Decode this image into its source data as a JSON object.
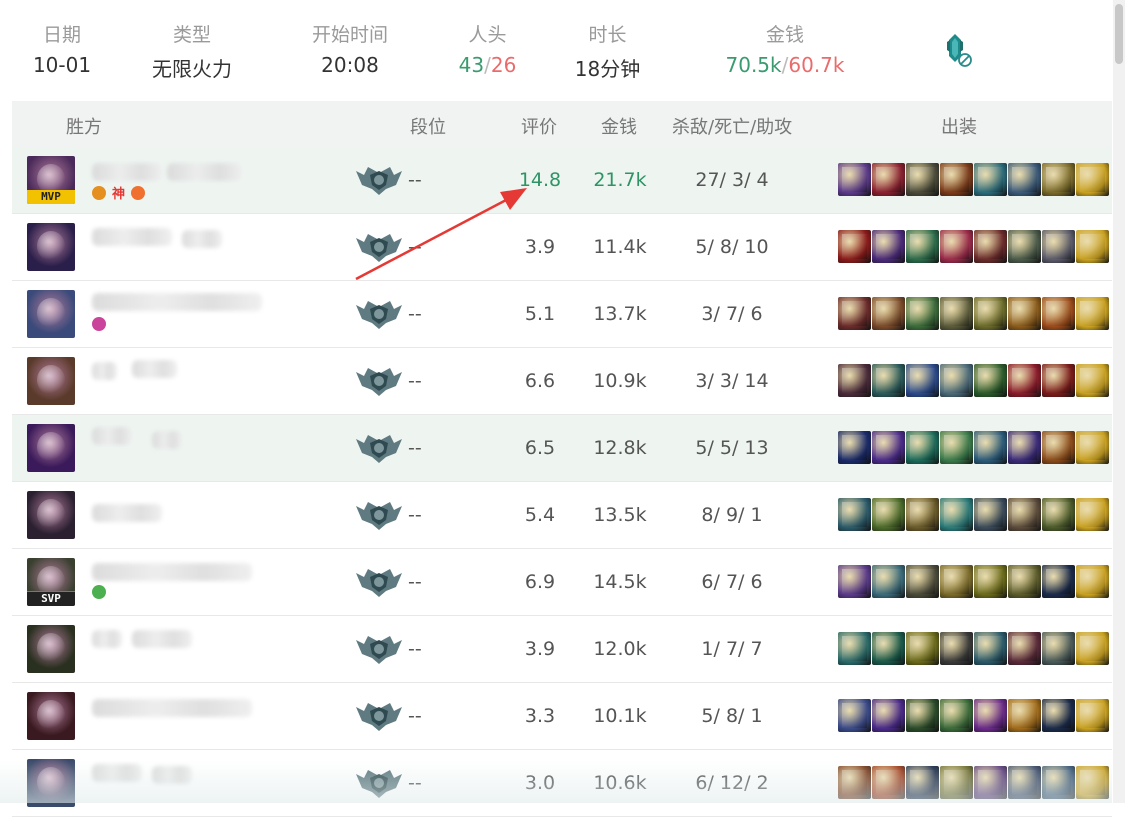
{
  "summary": {
    "date": {
      "label": "日期",
      "value": "10-01"
    },
    "type": {
      "label": "类型",
      "value": "无限火力"
    },
    "start": {
      "label": "开始时间",
      "value": "20:08"
    },
    "kills": {
      "label": "人头",
      "win": "43",
      "sep": "/",
      "lose": "26"
    },
    "duration": {
      "label": "时长",
      "value": "18分钟"
    },
    "money": {
      "label": "金钱",
      "win": "70.5k",
      "sep": "/",
      "lose": "60.7k"
    },
    "ban_icon": "ban-champion-icon"
  },
  "table": {
    "headers": {
      "side": "胜方",
      "rank": "段位",
      "score": "评价",
      "gold": "金钱",
      "kda": "杀敌/死亡/助攻",
      "items": "出装"
    },
    "rows": [
      {
        "rank": "--",
        "score": "14.8",
        "gold": "21.7k",
        "kda": "27/ 3/ 4",
        "badge": "MVP",
        "tags": [
          "神"
        ],
        "avatar_color": "#4a2a5a"
      },
      {
        "rank": "--",
        "score": "3.9",
        "gold": "11.4k",
        "kda": "5/ 8/ 10",
        "badge": "",
        "tags": [],
        "avatar_color": "#2a1f4a"
      },
      {
        "rank": "--",
        "score": "5.1",
        "gold": "13.7k",
        "kda": "3/ 7/ 6",
        "badge": "",
        "tags": [],
        "avatar_color": "#3a4a7a"
      },
      {
        "rank": "--",
        "score": "6.6",
        "gold": "10.9k",
        "kda": "3/ 3/ 14",
        "badge": "",
        "tags": [],
        "avatar_color": "#5a3a2a"
      },
      {
        "rank": "--",
        "score": "6.5",
        "gold": "12.8k",
        "kda": "5/ 5/ 13",
        "badge": "",
        "tags": [],
        "avatar_color": "#3a1a5a"
      },
      {
        "rank": "--",
        "score": "5.4",
        "gold": "13.5k",
        "kda": "8/ 9/ 1",
        "badge": "",
        "tags": [],
        "avatar_color": "#2a2030"
      },
      {
        "rank": "--",
        "score": "6.9",
        "gold": "14.5k",
        "kda": "6/ 7/ 6",
        "badge": "SVP",
        "tags": [],
        "avatar_color": "#3a4030"
      },
      {
        "rank": "--",
        "score": "3.9",
        "gold": "12.0k",
        "kda": "1/ 7/ 7",
        "badge": "",
        "tags": [],
        "avatar_color": "#2a3020"
      },
      {
        "rank": "--",
        "score": "3.3",
        "gold": "10.1k",
        "kda": "5/ 8/ 1",
        "badge": "",
        "tags": [],
        "avatar_color": "#3a1a20"
      },
      {
        "rank": "--",
        "score": "3.0",
        "gold": "10.6k",
        "kda": "6/ 12/ 2",
        "badge": "",
        "tags": [],
        "avatar_color": "#3a4a6a"
      }
    ]
  },
  "colors": {
    "win_green": "#3a9b6f",
    "lose_red": "#ea6b6b",
    "win_row_bg": "#eef5f1",
    "annotation_arrow": "#e53935"
  }
}
